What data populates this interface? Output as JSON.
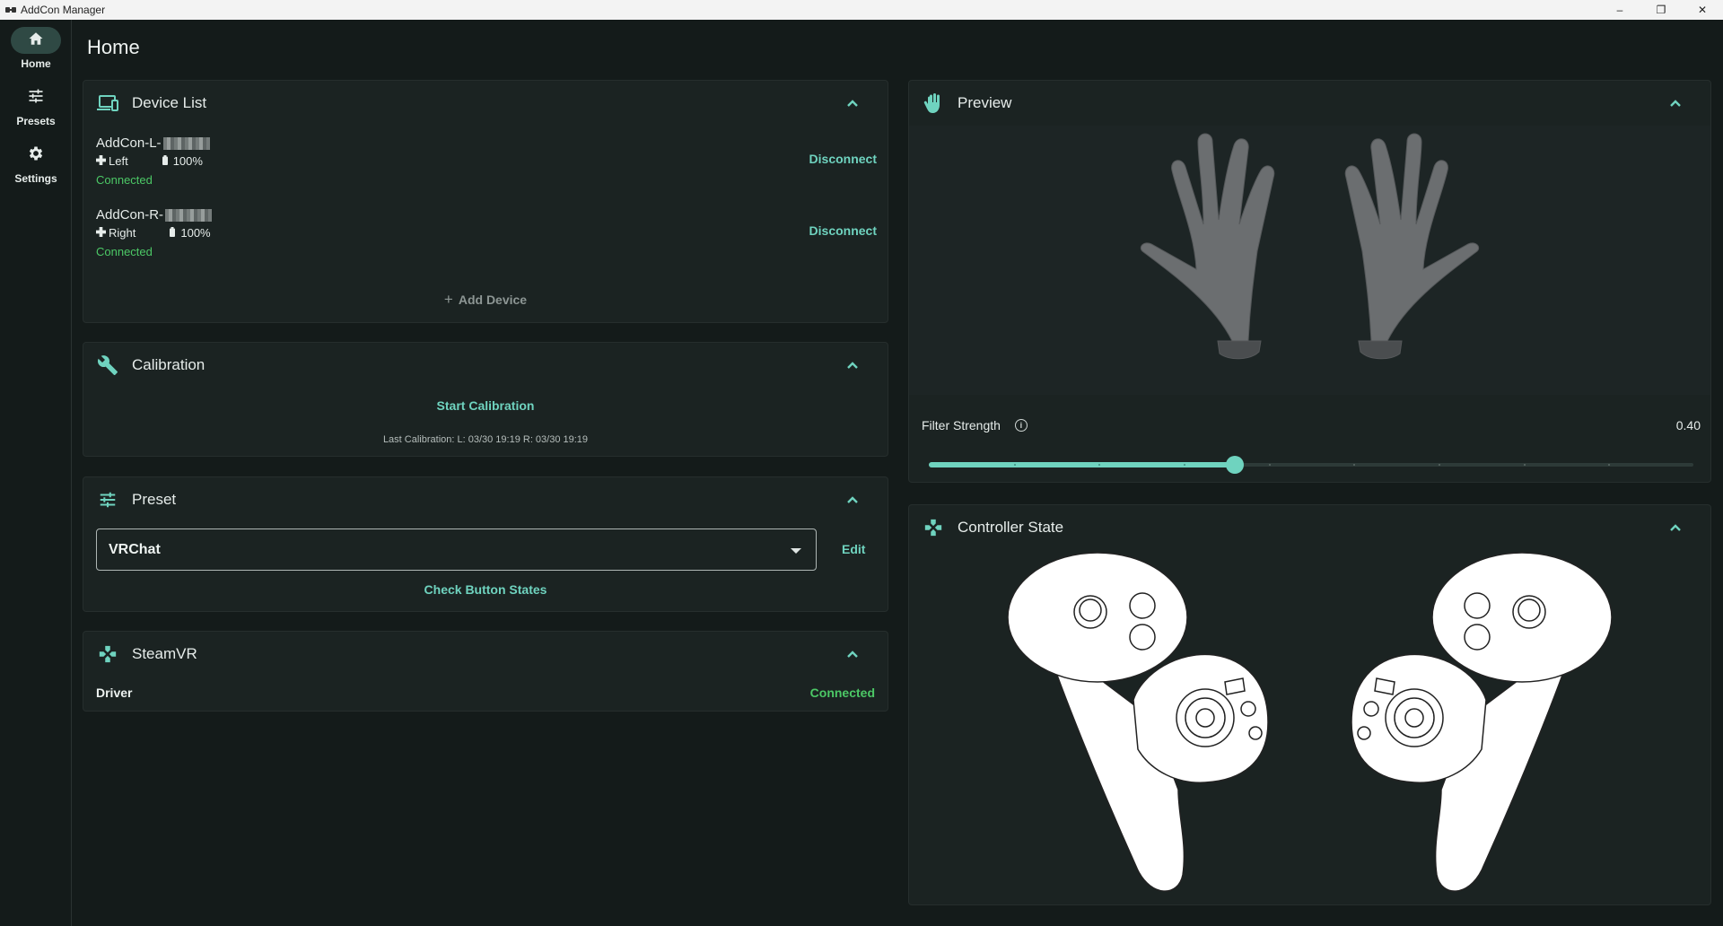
{
  "window": {
    "title": "AddCon Manager",
    "minimize": "–",
    "maximize": "❐",
    "close": "✕"
  },
  "nav": {
    "items": [
      {
        "label": "Home",
        "icon": "home-icon",
        "active": true
      },
      {
        "label": "Presets",
        "icon": "sliders-icon",
        "active": false
      },
      {
        "label": "Settings",
        "icon": "gear-icon",
        "active": false
      }
    ]
  },
  "page": {
    "title": "Home"
  },
  "device_list": {
    "title": "Device List",
    "devices": [
      {
        "name": "AddCon-L-",
        "side": "Left",
        "battery": "100%",
        "status": "Connected",
        "action": "Disconnect"
      },
      {
        "name": "AddCon-R-",
        "side": "Right",
        "battery": "100%",
        "status": "Connected",
        "action": "Disconnect"
      }
    ],
    "add_label": "Add Device"
  },
  "calibration": {
    "title": "Calibration",
    "start_label": "Start Calibration",
    "last_label": "Last Calibration: L: 03/30 19:19  R: 03/30 19:19"
  },
  "preset": {
    "title": "Preset",
    "selected": "VRChat",
    "edit_label": "Edit",
    "check_label": "Check Button States"
  },
  "steamvr": {
    "title": "SteamVR",
    "driver_label": "Driver",
    "driver_status": "Connected"
  },
  "preview": {
    "title": "Preview",
    "filter_label": "Filter Strength",
    "filter_value_text": "0.40",
    "filter_value": 0.4
  },
  "controller_state": {
    "title": "Controller State"
  },
  "colors": {
    "accent": "#6fd3bf",
    "connected": "#4cc866",
    "background": "#141b1a",
    "card": "#1b2322"
  }
}
